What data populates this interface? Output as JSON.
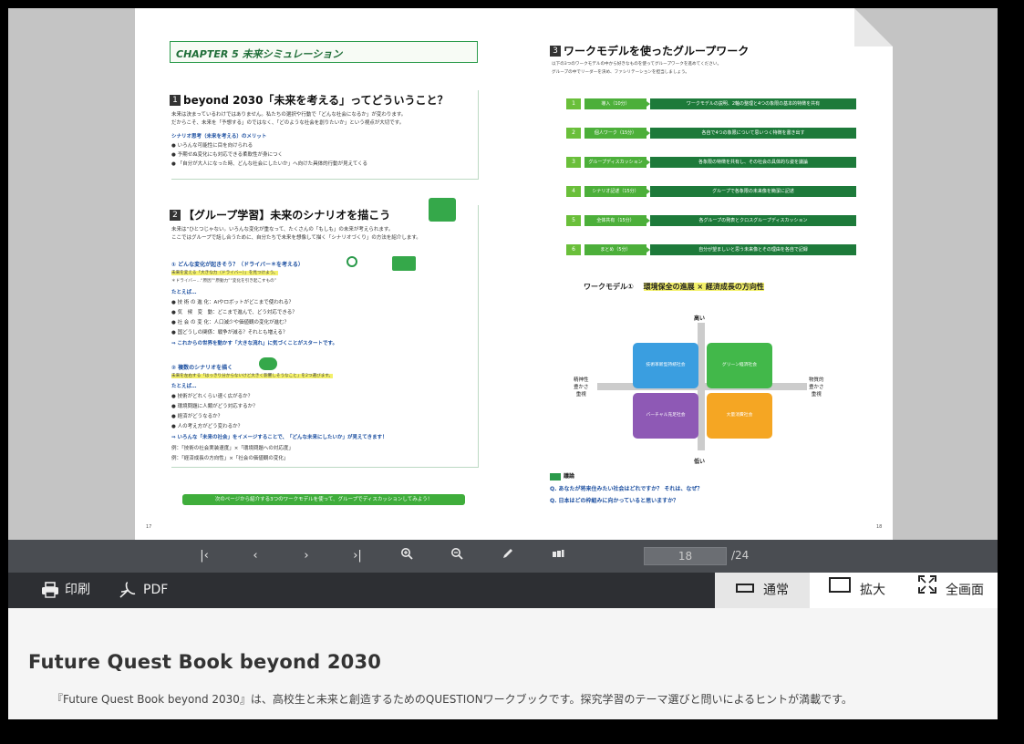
{
  "left_page": {
    "chapter": "CHAPTER 5 未来シミュレーション",
    "sec1": {
      "num": "1",
      "title": "beyond 2030「未来を考える」ってどういうこと？",
      "line1": "未来は決まっているわけではありません。私たちの選択や行動で「どんな社会になるか」が変わります。",
      "line2": "だからこそ、未来を「予想する」のではなく、「どのような社会を創りたいか」という視点が大切です。",
      "merit_title": "シナリオ思考（未来を考える）のメリット",
      "merits": [
        "いろんな可能性に目を向けられる",
        "予期せぬ変化にも対応できる柔軟性が身につく",
        "「自分が大人になった時、どんな社会にしたいか」へ向けた具体的行動が見えてくる"
      ]
    },
    "sec2": {
      "num": "2",
      "title": "【グループ学習】未来のシナリオを描こう",
      "line1": "未来は“ひとつじゃない。いろんな変化が重なって、たくさんの「もしも」の未来が考えられます。",
      "line2": "ここではグループで話し合うために、自分たちで未来を想像して描く「シナリオづくり」の方法を紹介します。",
      "step1": "① どんな変化が起きそう？（ドライバー＊を考える）",
      "step1_note": "未来を変える「大きな力（ドライバー）」を見つけよう。",
      "step1_note2": "＊ドライバー…“原因”“原動力”“変化を引き起こすもの”",
      "ex_label": "たとえば…",
      "examples1": [
        "技 術 の 進 化：AIやロボットがどこまで使われる？",
        "気　候　変　動：どこまで進んで、どう対応できる？",
        "社 会 の 変 化：人口減少や価値観の変化が進む？",
        "国どうしの関係：戦争が減る？それとも増える？"
      ],
      "step1_end": "これからの世界を動かす「大きな流れ」に気づくことがスタートです。",
      "step2": "② 複数のシナリオを描く",
      "step2_note": "未来を左右する「はっきり分からないけど大きく影響しそうなこと」を2つ選びます。",
      "examples2": [
        "技術がどれくらい速く広がるか？",
        "環境問題に人類がどう対応するか？",
        "経済がどうなるか？",
        "人の考え方がどう変わるか？"
      ],
      "step2_end": "いろんな「未来の社会」をイメージすることで、「どんな未来にしたいか」が見えてきます！",
      "pair1": "例：「技術の社会実装速度」×「環境問題への対応度」",
      "pair2": "例：「経済成長の方向性」×「社会の価値観の変化」",
      "bottom_banner": "次のページから紹介する3つのワークモデルを使って、グループでディスカッションしてみよう！",
      "page_no": "17"
    }
  },
  "right_page": {
    "sec3": {
      "num": "3",
      "title": "ワークモデルを使ったグループワーク",
      "line1": "以下の3つのワークモデルの中から好きなものを使ってグループワークを進めてください。",
      "line2": "グループの中でリーダーを決め、ファシリテーションを担当しましょう。"
    },
    "flow": [
      {
        "num": "1",
        "label": "導入（10分）",
        "desc": "ワークモデルの説明、2軸の整理と4つの象限の基本的特徴を共有"
      },
      {
        "num": "2",
        "label": "個人ワーク（15分）",
        "desc": "各自で4つの象限について思いつく特徴を書き出す"
      },
      {
        "num": "3",
        "label": "グループディスカッション（30分）",
        "desc": "各象限の特徴を共有し、その社会の具体的な姿を議論"
      },
      {
        "num": "4",
        "label": "シナリオ記述（15分）",
        "desc": "グループで各象限の未来像を簡潔に記述"
      },
      {
        "num": "5",
        "label": "全体共有（15分）",
        "desc": "各グループの発表とクロスグループディスカッション"
      },
      {
        "num": "6",
        "label": "まとめ（5分）",
        "desc": "自分が望ましいと思う未来像とその理由を各自で記録"
      }
    ],
    "model_title_prefix": "ワークモデル①",
    "model_title": "環境保全の進展 × 経済成長の方向性",
    "axis": {
      "top": "高い",
      "bottom": "低い",
      "left": [
        "精神性",
        "豊かさ",
        "重視"
      ],
      "right": [
        "物質的",
        "豊かさ",
        "重視"
      ]
    },
    "quadrants": [
      {
        "label": "技術革新型持続社会",
        "color": "#3a9ee0"
      },
      {
        "label": "グリーン経済社会",
        "color": "#42b84a"
      },
      {
        "label": "バーチャル充足社会",
        "color": "#8e59b5"
      },
      {
        "label": "大量消費社会",
        "color": "#f5a623"
      }
    ],
    "discussion_label": "議論",
    "q1": "Q. あなたが将来住みたい社会はどれですか？ それは、なぜ？",
    "q2": "Q. 日本はどの枠組みに向かっていると思いますか？",
    "page_no": "18"
  },
  "toolbar": {
    "current_page": "18",
    "total_pages": "/24",
    "icons": [
      "first-page-icon",
      "prev-page-icon",
      "next-page-icon",
      "last-page-icon",
      "zoom-in-icon",
      "zoom-out-icon",
      "pen-icon",
      "thumbnails-icon"
    ]
  },
  "actions": {
    "print": "印刷",
    "pdf": "PDF",
    "mode_normal": "通常",
    "mode_zoom": "拡大",
    "mode_fullscreen": "全画面"
  },
  "description": {
    "title": "Future Quest Book beyond 2030",
    "text": "『Future Quest Book beyond 2030』は、高校生と未来と創造するためのQUESTIONワークブックです。探究学習のテーマ選びと問いによるヒントが満載です。"
  },
  "colors": {
    "accent_green": "#1f8c3a",
    "toolbar": "#4a4d52",
    "actionbar": "#2d2f33"
  }
}
